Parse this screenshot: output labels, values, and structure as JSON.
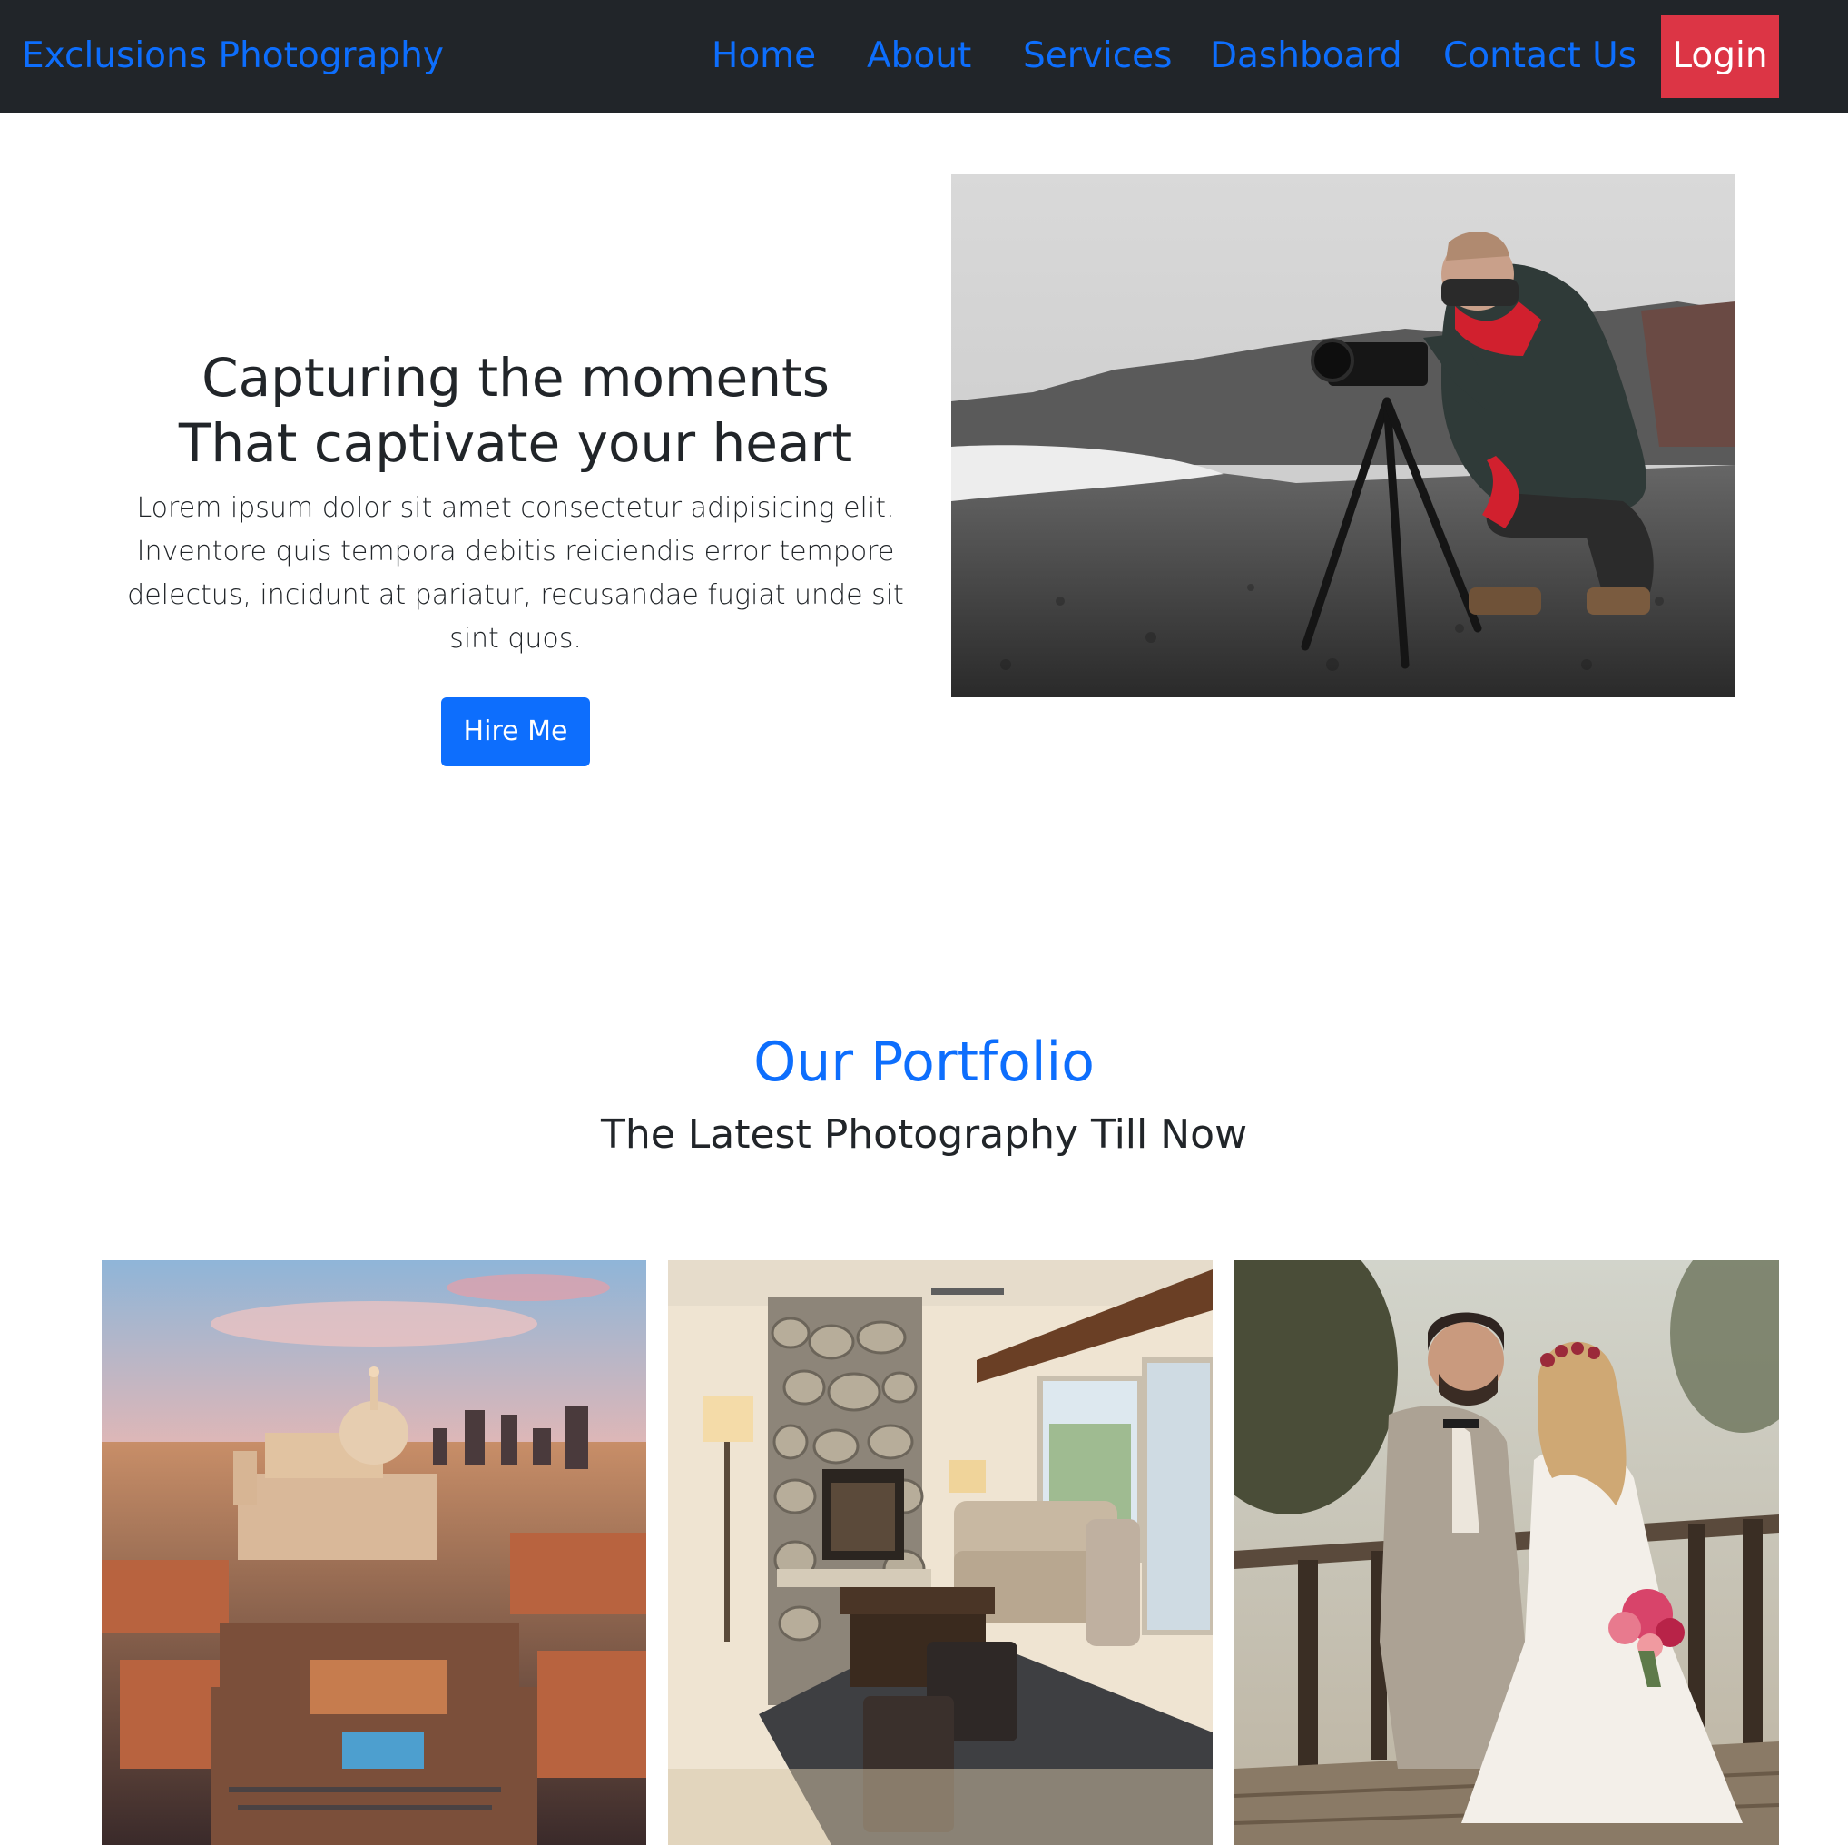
{
  "navbar": {
    "brand": "Exclusions Photography",
    "links": [
      "Home",
      "About",
      "Services",
      "Dashboard",
      "Contact Us"
    ],
    "login_label": "Login"
  },
  "hero": {
    "title_line1": "Capturing the moments",
    "title_line2": "That captivate your heart",
    "body": "Lorem ipsum dolor sit amet consectetur adipisicing elit. Inventore quis tempora debitis reiciendis error tempore delectus, incidunt at pariatur, recusandae fugiat unde sit sint quos.",
    "button_label": "Hire Me"
  },
  "portfolio": {
    "title": "Our Portfolio",
    "subtitle": "The Latest Photography Till Now"
  },
  "colors": {
    "navbar_bg": "#212529",
    "link": "#0d6efd",
    "login_bg": "#dc3545",
    "primary_button": "#0d6efd"
  }
}
